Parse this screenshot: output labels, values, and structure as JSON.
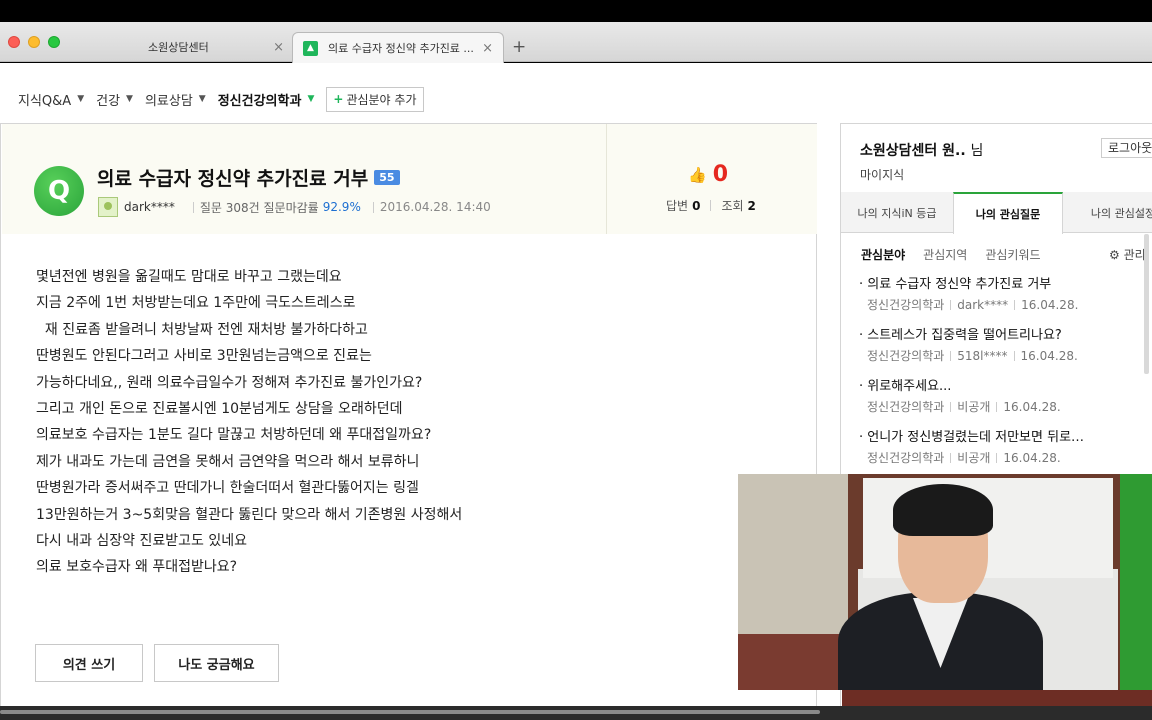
{
  "browser": {
    "tabs": [
      {
        "label": "소원상담센터",
        "close": "×"
      },
      {
        "label": "의료 수급자 정신약 추가진료 ...",
        "close": "×"
      }
    ],
    "new_tab": "+"
  },
  "breadcrumb": {
    "items": [
      "지식Q&A",
      "건강",
      "의료상담",
      "정신건강의학과"
    ],
    "arrow": "▼",
    "add_interest": "관심분야 추가",
    "add_plus": "+"
  },
  "question": {
    "badge": "Q",
    "title": "의료 수급자 정신약 추가진료 거부",
    "level": "55",
    "author": "dark****",
    "stats_text": "질문 308건 질문마감률",
    "close_rate": "92.9%",
    "date": "2016.04.28. 14:40",
    "likes": "0",
    "answers_label": "답변",
    "answers": "0",
    "views_label": "조회",
    "views": "2",
    "body": [
      "몇년전엔 병원을 옮길때도 맘대로 바꾸고 그랬는데요",
      "지금 2주에 1번 처방받는데요 1주만에 극도스트레스로",
      "  재 진료좀 받을려니 처방날짜 전엔 재처방 불가하다하고",
      "딴병원도 안된다그러고 사비로 3만원넘는금액으로 진료는",
      "가능하다네요,, 원래 의료수급일수가 정해져 추가진료 불가인가요?",
      "그리고 개인 돈으로 진료볼시엔 10분넘게도 상담을 오래하던데",
      "의료보호 수급자는 1분도 길다 말끊고 처방하던데 왜 푸대접일까요?",
      "제가 내과도 가는데 금연을 못해서 금연약을 먹으라 해서 보류하니",
      "딴병원가라 증서써주고 딴데가니 한술더떠서 혈관다뚫어지는 링겔",
      "13만원하는거 3~5회맞음 혈관다 뚫린다 맞으라 해서 기존병원 사정해서",
      "다시 내과 심장약 진료받고도 있네요",
      "의료 보호수급자 왜 푸대접받나요?"
    ],
    "buttons": {
      "opinion": "의견 쓰기",
      "curious": "나도 궁금해요"
    }
  },
  "sidebar": {
    "user_name": "소원상담센터 원..",
    "honorific": "님",
    "login": "로그아웃",
    "my_knowledge": "마이지식",
    "tabs": [
      "나의 지식iN 등급",
      "나의 관심질문",
      "나의 관심설정"
    ],
    "subtabs": [
      "관심분야",
      "관심지역",
      "관심키워드"
    ],
    "manage": "관리",
    "items": [
      {
        "title": "의료 수급자 정신약 추가진료 거부",
        "category": "정신건강의학과",
        "author": "dark****",
        "date": "16.04.28."
      },
      {
        "title": "스트레스가 집중력을 떨어트리나요?",
        "category": "정신건강의학과",
        "author": "518l****",
        "date": "16.04.28."
      },
      {
        "title": "위로해주세요...",
        "category": "정신건강의학과",
        "author": "비공개",
        "date": "16.04.28."
      },
      {
        "title": "언니가 정신병걸렸는데 저만보면 뒤로…",
        "category": "정신건강의학과",
        "author": "비공개",
        "date": "16.04.28."
      }
    ]
  },
  "colors": {
    "brand_green": "#2aa43a",
    "level_blue": "#4a8be2",
    "likes_red": "#e5281f"
  }
}
